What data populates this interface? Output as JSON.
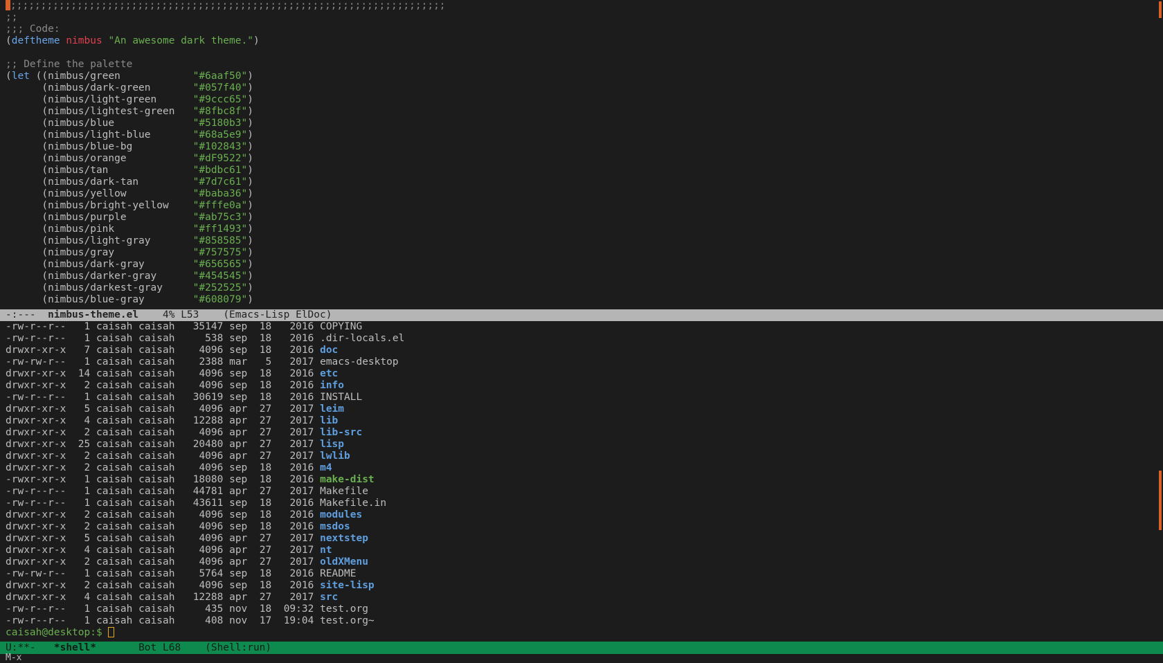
{
  "colors": {
    "comment": "#8a8a8a",
    "keyword": "#68a5e9",
    "func_name": "#e0414f",
    "string": "#6aaf50",
    "dir": "#5f9fe0",
    "exec": "#6aaf50",
    "cursor": "#d9622a",
    "prompt": "#6aaf50",
    "prompt_cursor": "#e6a817",
    "modeline_top_bg": "#b5b5b5",
    "modeline_bot_bg": "#0e8a4e"
  },
  "editor": {
    "line_1": ";;;;;;;;;;;;;;;;;;;;;;;;;;;;;;;;;;;;;;;;;;;;;;;;;;;;;;;;;;;;;;;;;;;;;;;;",
    "line_2": ";;",
    "line_3": ";;; Code:",
    "deftheme": {
      "open": "(",
      "keyword": "deftheme",
      "name": "nimbus",
      "doc": "\"An awesome dark theme.\"",
      "close": ")"
    },
    "palette_comment": ";; Define the palette",
    "let_keyword": "let",
    "palette": [
      {
        "name": "nimbus/green",
        "value": "\"#6aaf50\""
      },
      {
        "name": "nimbus/dark-green",
        "value": "\"#057f40\""
      },
      {
        "name": "nimbus/light-green",
        "value": "\"#9ccc65\""
      },
      {
        "name": "nimbus/lightest-green",
        "value": "\"#8fbc8f\""
      },
      {
        "name": "nimbus/blue",
        "value": "\"#5180b3\""
      },
      {
        "name": "nimbus/light-blue",
        "value": "\"#68a5e9\""
      },
      {
        "name": "nimbus/blue-bg",
        "value": "\"#102843\""
      },
      {
        "name": "nimbus/orange",
        "value": "\"#dF9522\""
      },
      {
        "name": "nimbus/tan",
        "value": "\"#bdbc61\""
      },
      {
        "name": "nimbus/dark-tan",
        "value": "\"#7d7c61\""
      },
      {
        "name": "nimbus/yellow",
        "value": "\"#baba36\""
      },
      {
        "name": "nimbus/bright-yellow",
        "value": "\"#fffe0a\""
      },
      {
        "name": "nimbus/purple",
        "value": "\"#ab75c3\""
      },
      {
        "name": "nimbus/pink",
        "value": "\"#ff1493\""
      },
      {
        "name": "nimbus/light-gray",
        "value": "\"#858585\""
      },
      {
        "name": "nimbus/gray",
        "value": "\"#757575\""
      },
      {
        "name": "nimbus/dark-gray",
        "value": "\"#656565\""
      },
      {
        "name": "nimbus/darker-gray",
        "value": "\"#454545\""
      },
      {
        "name": "nimbus/darkest-gray",
        "value": "\"#252525\""
      },
      {
        "name": "nimbus/blue-gray",
        "value": "\"#608079\""
      }
    ]
  },
  "modeline_top": {
    "state": "-:---",
    "buffer": "nimbus-theme.el",
    "position": "4% L53",
    "modes": "(Emacs-Lisp ElDoc)"
  },
  "shell": {
    "entries": [
      {
        "perm": "-rw-r--r--",
        "links": "1",
        "owner": "caisah",
        "group": "caisah",
        "size": "35147",
        "month": "sep",
        "day": "18",
        "time": "2016",
        "name": "COPYING",
        "kind": "file"
      },
      {
        "perm": "-rw-r--r--",
        "links": "1",
        "owner": "caisah",
        "group": "caisah",
        "size": "538",
        "month": "sep",
        "day": "18",
        "time": "2016",
        "name": ".dir-locals.el",
        "kind": "file"
      },
      {
        "perm": "drwxr-xr-x",
        "links": "7",
        "owner": "caisah",
        "group": "caisah",
        "size": "4096",
        "month": "sep",
        "day": "18",
        "time": "2016",
        "name": "doc",
        "kind": "dir"
      },
      {
        "perm": "-rw-rw-r--",
        "links": "1",
        "owner": "caisah",
        "group": "caisah",
        "size": "2388",
        "month": "mar",
        "day": "5",
        "time": "2017",
        "name": "emacs-desktop",
        "kind": "file"
      },
      {
        "perm": "drwxr-xr-x",
        "links": "14",
        "owner": "caisah",
        "group": "caisah",
        "size": "4096",
        "month": "sep",
        "day": "18",
        "time": "2016",
        "name": "etc",
        "kind": "dir"
      },
      {
        "perm": "drwxr-xr-x",
        "links": "2",
        "owner": "caisah",
        "group": "caisah",
        "size": "4096",
        "month": "sep",
        "day": "18",
        "time": "2016",
        "name": "info",
        "kind": "dir"
      },
      {
        "perm": "-rw-r--r--",
        "links": "1",
        "owner": "caisah",
        "group": "caisah",
        "size": "30619",
        "month": "sep",
        "day": "18",
        "time": "2016",
        "name": "INSTALL",
        "kind": "file"
      },
      {
        "perm": "drwxr-xr-x",
        "links": "5",
        "owner": "caisah",
        "group": "caisah",
        "size": "4096",
        "month": "apr",
        "day": "27",
        "time": "2017",
        "name": "leim",
        "kind": "dir"
      },
      {
        "perm": "drwxr-xr-x",
        "links": "4",
        "owner": "caisah",
        "group": "caisah",
        "size": "12288",
        "month": "apr",
        "day": "27",
        "time": "2017",
        "name": "lib",
        "kind": "dir"
      },
      {
        "perm": "drwxr-xr-x",
        "links": "2",
        "owner": "caisah",
        "group": "caisah",
        "size": "4096",
        "month": "apr",
        "day": "27",
        "time": "2017",
        "name": "lib-src",
        "kind": "dir"
      },
      {
        "perm": "drwxr-xr-x",
        "links": "25",
        "owner": "caisah",
        "group": "caisah",
        "size": "20480",
        "month": "apr",
        "day": "27",
        "time": "2017",
        "name": "lisp",
        "kind": "dir"
      },
      {
        "perm": "drwxr-xr-x",
        "links": "2",
        "owner": "caisah",
        "group": "caisah",
        "size": "4096",
        "month": "apr",
        "day": "27",
        "time": "2017",
        "name": "lwlib",
        "kind": "dir"
      },
      {
        "perm": "drwxr-xr-x",
        "links": "2",
        "owner": "caisah",
        "group": "caisah",
        "size": "4096",
        "month": "sep",
        "day": "18",
        "time": "2016",
        "name": "m4",
        "kind": "dir"
      },
      {
        "perm": "-rwxr-xr-x",
        "links": "1",
        "owner": "caisah",
        "group": "caisah",
        "size": "18080",
        "month": "sep",
        "day": "18",
        "time": "2016",
        "name": "make-dist",
        "kind": "exec"
      },
      {
        "perm": "-rw-r--r--",
        "links": "1",
        "owner": "caisah",
        "group": "caisah",
        "size": "44781",
        "month": "apr",
        "day": "27",
        "time": "2017",
        "name": "Makefile",
        "kind": "file"
      },
      {
        "perm": "-rw-r--r--",
        "links": "1",
        "owner": "caisah",
        "group": "caisah",
        "size": "43611",
        "month": "sep",
        "day": "18",
        "time": "2016",
        "name": "Makefile.in",
        "kind": "file"
      },
      {
        "perm": "drwxr-xr-x",
        "links": "2",
        "owner": "caisah",
        "group": "caisah",
        "size": "4096",
        "month": "sep",
        "day": "18",
        "time": "2016",
        "name": "modules",
        "kind": "dir"
      },
      {
        "perm": "drwxr-xr-x",
        "links": "2",
        "owner": "caisah",
        "group": "caisah",
        "size": "4096",
        "month": "sep",
        "day": "18",
        "time": "2016",
        "name": "msdos",
        "kind": "dir"
      },
      {
        "perm": "drwxr-xr-x",
        "links": "5",
        "owner": "caisah",
        "group": "caisah",
        "size": "4096",
        "month": "apr",
        "day": "27",
        "time": "2017",
        "name": "nextstep",
        "kind": "dir"
      },
      {
        "perm": "drwxr-xr-x",
        "links": "4",
        "owner": "caisah",
        "group": "caisah",
        "size": "4096",
        "month": "apr",
        "day": "27",
        "time": "2017",
        "name": "nt",
        "kind": "dir"
      },
      {
        "perm": "drwxr-xr-x",
        "links": "2",
        "owner": "caisah",
        "group": "caisah",
        "size": "4096",
        "month": "apr",
        "day": "27",
        "time": "2017",
        "name": "oldXMenu",
        "kind": "dir"
      },
      {
        "perm": "-rw-rw-r--",
        "links": "1",
        "owner": "caisah",
        "group": "caisah",
        "size": "5764",
        "month": "sep",
        "day": "18",
        "time": "2016",
        "name": "README",
        "kind": "file"
      },
      {
        "perm": "drwxr-xr-x",
        "links": "2",
        "owner": "caisah",
        "group": "caisah",
        "size": "4096",
        "month": "sep",
        "day": "18",
        "time": "2016",
        "name": "site-lisp",
        "kind": "dir"
      },
      {
        "perm": "drwxr-xr-x",
        "links": "4",
        "owner": "caisah",
        "group": "caisah",
        "size": "12288",
        "month": "apr",
        "day": "27",
        "time": "2017",
        "name": "src",
        "kind": "dir"
      },
      {
        "perm": "-rw-r--r--",
        "links": "1",
        "owner": "caisah",
        "group": "caisah",
        "size": "435",
        "month": "nov",
        "day": "18",
        "time": "09:32",
        "name": "test.org",
        "kind": "file"
      },
      {
        "perm": "-rw-r--r--",
        "links": "1",
        "owner": "caisah",
        "group": "caisah",
        "size": "408",
        "month": "nov",
        "day": "17",
        "time": "19:04",
        "name": "test.org~",
        "kind": "file"
      }
    ],
    "prompt": "caisah@desktop:$ "
  },
  "modeline_bot": {
    "state": "U:**-",
    "buffer": "*shell*",
    "position": "Bot L68",
    "modes": "(Shell:run)"
  },
  "minibuffer": {
    "text": "M-x"
  }
}
